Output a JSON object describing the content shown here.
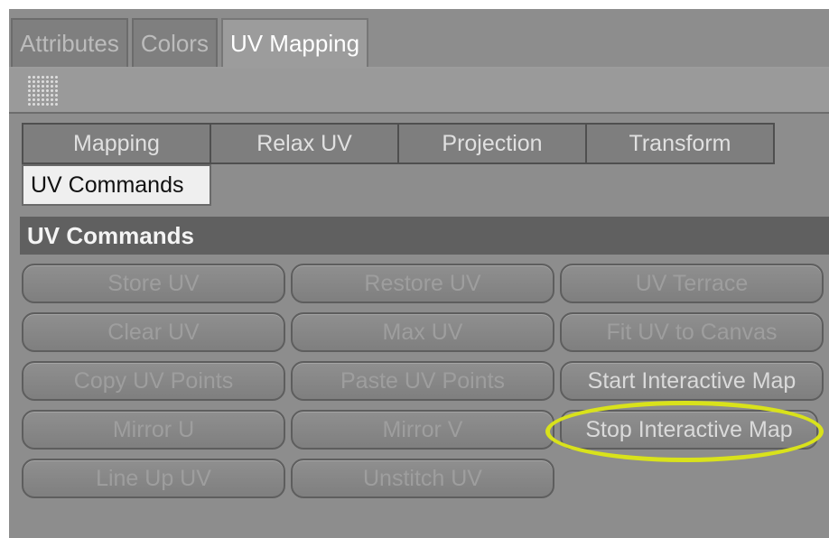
{
  "top_tabs": [
    "Attributes",
    "Colors",
    "UV Mapping"
  ],
  "sub_tabs": [
    "Mapping",
    "Relax UV",
    "Projection",
    "Transform"
  ],
  "active_sub_tab": "UV Commands",
  "section_title": "UV Commands",
  "buttons": [
    "Store UV",
    "Restore UV",
    "UV Terrace",
    "Clear UV",
    "Max UV",
    "Fit UV to Canvas",
    "Copy UV Points",
    "Paste UV Points",
    "Start Interactive Map",
    "Mirror U",
    "Mirror V",
    "Stop Interactive Map",
    "Line Up UV",
    "Unstitch UV"
  ],
  "colors": {
    "panel_bg": "#8d8d8d",
    "highlight": "#d9e21b"
  }
}
